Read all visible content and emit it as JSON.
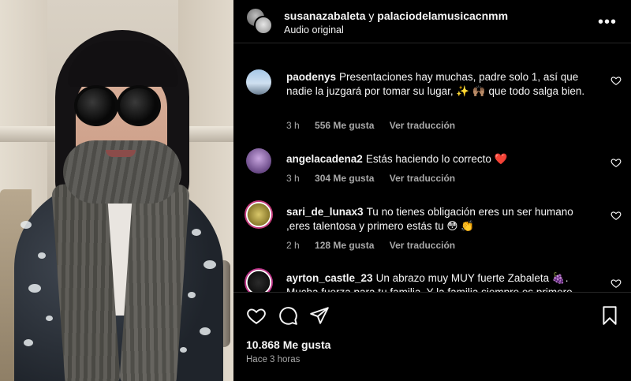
{
  "post": {
    "author_primary": "susanazabaleta",
    "author_connector": "y",
    "author_secondary": "palaciodelamusicacnmm",
    "audio_label": "Audio original",
    "more_label": "•••"
  },
  "comments": [
    {
      "username": "paodenys",
      "text": "Presentaciones hay muchas, padre solo 1, así que nadie la juzgará por tomar su lugar, ✨ 🙌🏽 que todo salga bien.",
      "time": "3 h",
      "likes": "556 Me gusta",
      "translate": "Ver traducción"
    },
    {
      "username": "angelacadena2",
      "text": "Estás haciendo lo correcto ❤️",
      "time": "3 h",
      "likes": "304 Me gusta",
      "translate": "Ver traducción"
    },
    {
      "username": "sari_de_lunax3",
      "text": "Tu no tienes obligación eres un ser humano ,eres talentosa y primero estás tu 😳 👏",
      "time": "2 h",
      "likes": "128 Me gusta",
      "translate": "Ver traducción"
    },
    {
      "username": "ayrton_castle_23",
      "text": "Un abrazo muy MUY fuerte Zabaleta 🍇. Mucha fuerza para tu familia. Y la familia siempre es primero",
      "time": "",
      "likes": "",
      "translate": ""
    }
  ],
  "footer": {
    "likes": "10.868 Me gusta",
    "time_ago": "Hace 3 horas"
  },
  "icons": {
    "like": "heart-icon",
    "comment": "comment-icon",
    "share": "share-icon",
    "save": "bookmark-icon",
    "more": "more-icon"
  },
  "colors": {
    "background": "#000000",
    "text": "#f5f5f5",
    "secondary_text": "#a8a8a8",
    "divider": "#262626"
  }
}
